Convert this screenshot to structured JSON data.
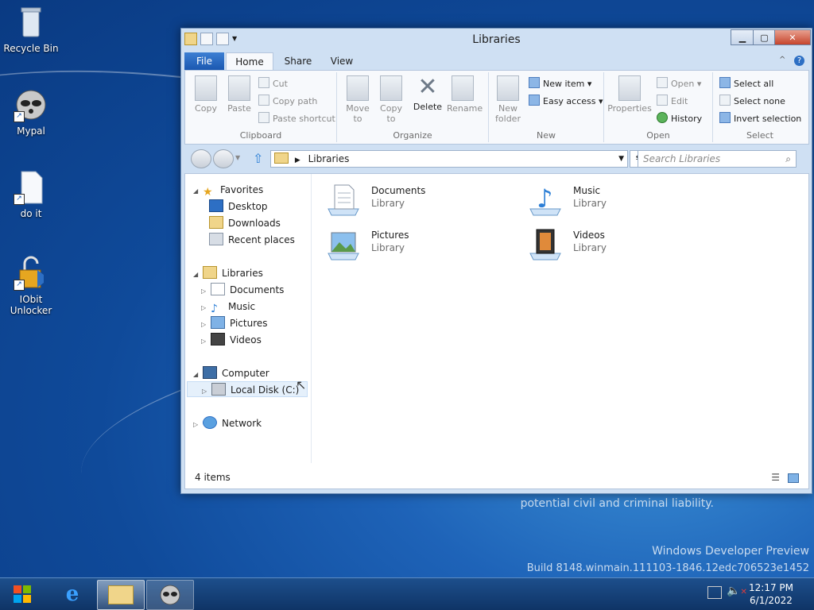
{
  "desktop": {
    "icons": [
      {
        "label": "Recycle Bin"
      },
      {
        "label": "Mypal"
      },
      {
        "label": "do it"
      },
      {
        "label": "IObit Unlocker"
      }
    ],
    "watermark_line1": "potential civil and criminal liability.",
    "watermark_line2": "Windows Developer Preview",
    "watermark_line3": "Build 8148.winmain.111103-1846.12edc706523e1452"
  },
  "window": {
    "title": "Libraries",
    "tabs": {
      "file": "File",
      "home": "Home",
      "share": "Share",
      "view": "View"
    },
    "ribbon": {
      "clipboard": {
        "label": "Clipboard",
        "copy": "Copy",
        "paste": "Paste",
        "cut": "Cut",
        "copy_path": "Copy path",
        "paste_shortcut": "Paste shortcut"
      },
      "organize": {
        "label": "Organize",
        "move_to": "Move to",
        "copy_to": "Copy to",
        "delete": "Delete",
        "rename": "Rename"
      },
      "new": {
        "label": "New",
        "new_folder": "New folder",
        "new_item": "New item",
        "easy_access": "Easy access"
      },
      "open": {
        "label": "Open",
        "properties": "Properties",
        "open": "Open",
        "edit": "Edit",
        "history": "History"
      },
      "select": {
        "label": "Select",
        "select_all": "Select all",
        "select_none": "Select none",
        "invert_selection": "Invert selection"
      }
    },
    "address": {
      "path": "Libraries"
    },
    "search": {
      "placeholder": "Search Libraries"
    },
    "nav_tree": {
      "favorites": "Favorites",
      "desktop": "Desktop",
      "downloads": "Downloads",
      "recent": "Recent places",
      "libraries": "Libraries",
      "documents": "Documents",
      "music": "Music",
      "pictures": "Pictures",
      "videos": "Videos",
      "computer": "Computer",
      "local_disk": "Local Disk (C:)",
      "network": "Network"
    },
    "libraries": [
      {
        "name": "Documents",
        "type": "Library"
      },
      {
        "name": "Music",
        "type": "Library"
      },
      {
        "name": "Pictures",
        "type": "Library"
      },
      {
        "name": "Videos",
        "type": "Library"
      }
    ],
    "status": {
      "count": "4 items"
    }
  },
  "taskbar": {
    "time": "12:17 PM",
    "date": "6/1/2022"
  },
  "colors": {
    "accent": "#1b58b0",
    "selection": "#e5f0fb"
  }
}
